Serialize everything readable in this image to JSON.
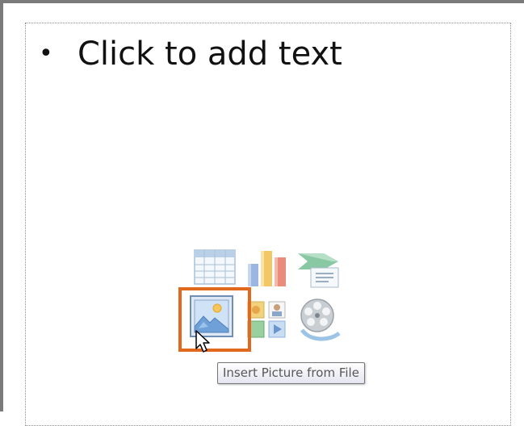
{
  "slide": {
    "bullet_glyph": "•",
    "placeholder_text": "Click to add text"
  },
  "content_icons": [
    {
      "name": "insert-table-icon",
      "tooltip": ""
    },
    {
      "name": "insert-chart-icon",
      "tooltip": ""
    },
    {
      "name": "insert-smartart-icon",
      "tooltip": ""
    },
    {
      "name": "insert-picture-icon",
      "tooltip": "Insert Picture from File"
    },
    {
      "name": "insert-clip-art-icon",
      "tooltip": ""
    },
    {
      "name": "insert-media-icon",
      "tooltip": ""
    }
  ],
  "tooltip": {
    "text": "Insert Picture from File"
  },
  "colors": {
    "highlight": "#e0691e",
    "frame": "#7a7a7a",
    "placeholder_border": "#8c8c8c"
  }
}
